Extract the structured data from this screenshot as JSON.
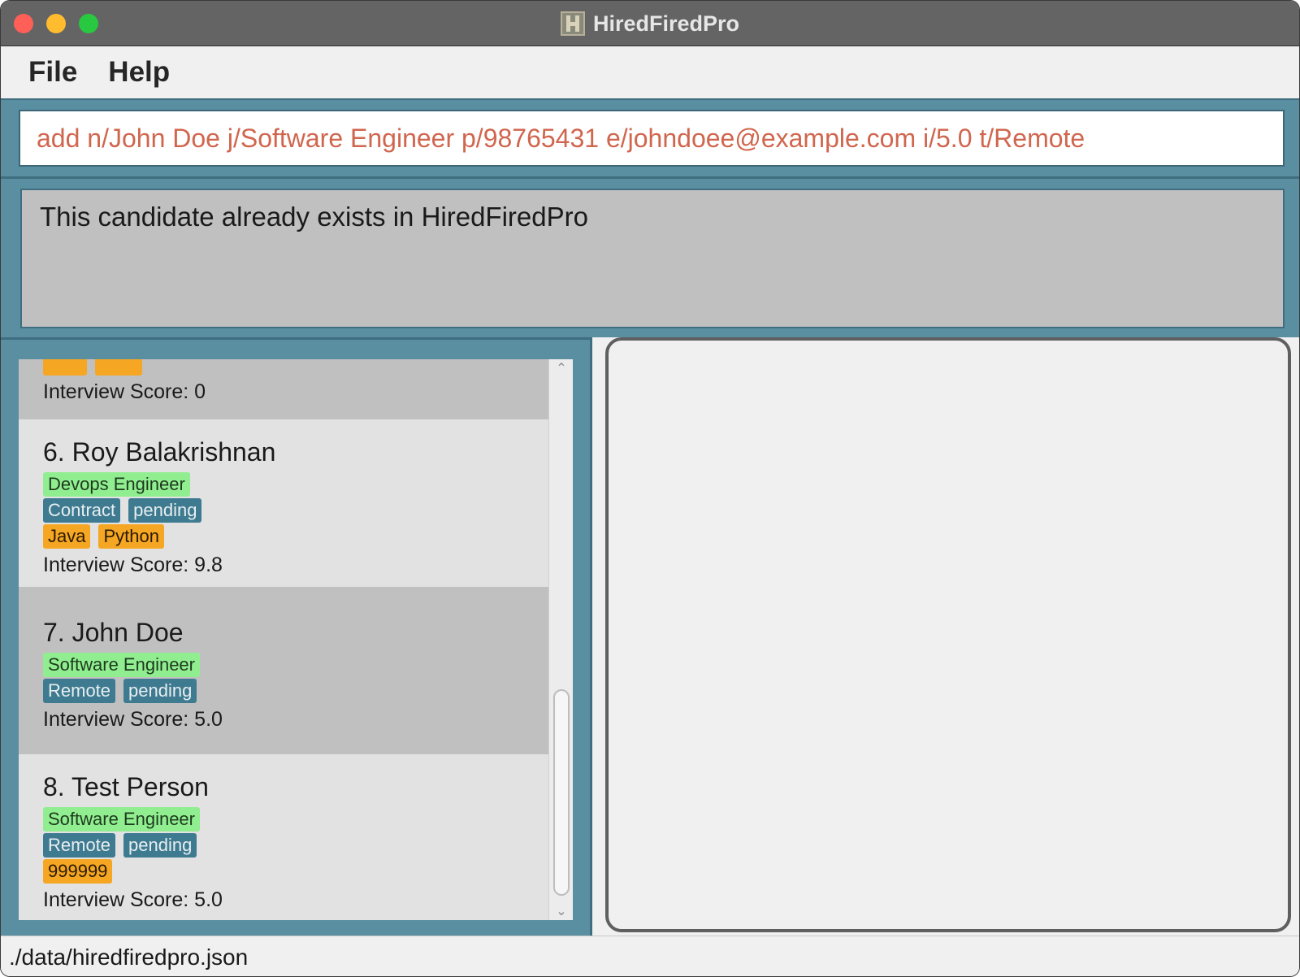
{
  "window": {
    "title": "HiredFiredPro"
  },
  "menu": {
    "file": "File",
    "help": "Help"
  },
  "command": {
    "value": "add n/John Doe j/Software Engineer p/98765431 e/johndoee@example.com i/5.0 t/Remote"
  },
  "result": {
    "message": "This candidate already exists in HiredFiredPro"
  },
  "candidates": {
    "partial": {
      "score": "Interview Score: 0"
    },
    "items": [
      {
        "name": "6. Roy Balakrishnan",
        "role": "Devops Engineer",
        "statuses": [
          "Contract",
          "pending"
        ],
        "skills": [
          "Java",
          "Python"
        ],
        "score": "Interview Score: 9.8"
      },
      {
        "name": "7. John Doe",
        "role": "Software Engineer",
        "statuses": [
          "Remote",
          "pending"
        ],
        "score": "Interview Score: 5.0"
      },
      {
        "name": "8. Test Person",
        "role": "Software Engineer",
        "statuses": [
          "Remote",
          "pending"
        ],
        "skills": [
          "999999"
        ],
        "score": "Interview Score: 5.0"
      }
    ]
  },
  "status": {
    "filepath": "./data/hiredfiredpro.json"
  },
  "colors": {
    "panel_bg": "#5a8fa2",
    "role_tag": "#90ee90",
    "status_tag": "#3e7b91",
    "skill_tag": "#f5a623",
    "command_text": "#d0664e"
  }
}
